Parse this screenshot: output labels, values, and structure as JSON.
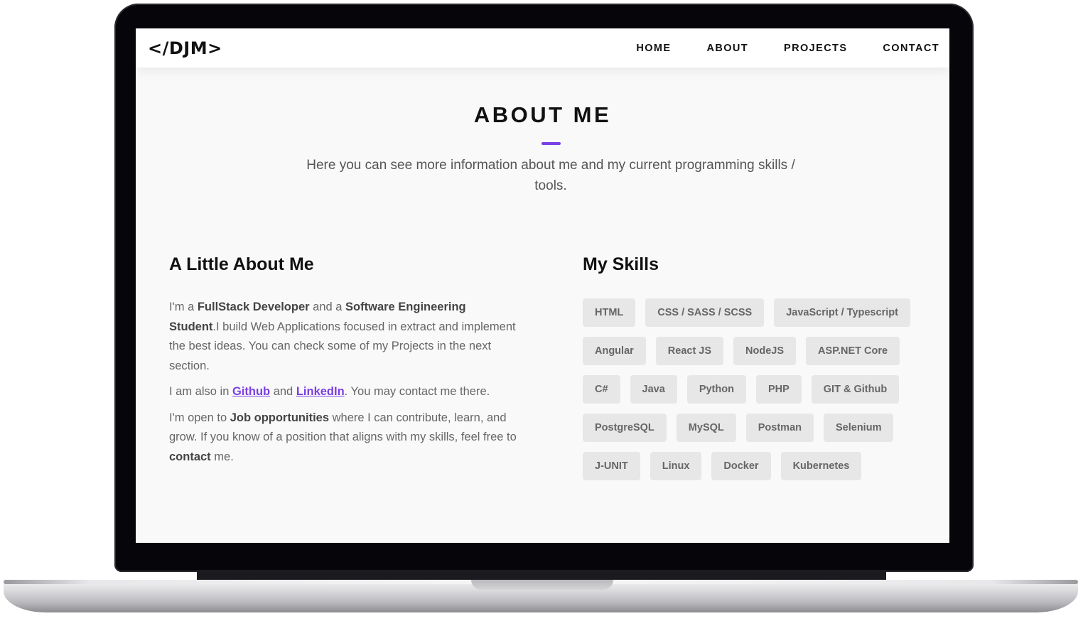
{
  "brand": {
    "logo": "</DJM>"
  },
  "nav": {
    "items": [
      {
        "label": "HOME"
      },
      {
        "label": "ABOUT"
      },
      {
        "label": "PROJECTS"
      },
      {
        "label": "CONTACT"
      }
    ]
  },
  "section": {
    "title": "ABOUT ME",
    "subtitle": "Here you can see more information about me and my current programming skills / tools."
  },
  "about": {
    "heading": "A Little About Me",
    "p1": {
      "t1": "I'm a ",
      "b1": "FullStack Developer",
      "t2": " and a ",
      "b2": "Software Engineering Student",
      "t3": ".I build Web Applications focused in extract and implement the best ideas. You can check some of my Projects in the next section."
    },
    "p2": {
      "t1": "I am also in ",
      "link1": "Github",
      "t2": " and ",
      "link2": "LinkedIn",
      "t3": ". You may contact me there."
    },
    "p3": {
      "t1": "I'm open to ",
      "b1": "Job opportunities",
      "t2": " where I can contribute, learn, and grow. If you know of a position that aligns with my skills, feel free to ",
      "b2": "contact",
      "t3": " me."
    }
  },
  "skills": {
    "heading": "My Skills",
    "items": [
      "HTML",
      "CSS / SASS / SCSS",
      "JavaScript / Typescript",
      "Angular",
      "React JS",
      "NodeJS",
      "ASP.NET Core",
      "C#",
      "Java",
      "Python",
      "PHP",
      "GIT & Github",
      "PostgreSQL",
      "MySQL",
      "Postman",
      "Selenium",
      "J-UNIT",
      "Linux",
      "Docker",
      "Kubernetes"
    ]
  },
  "colors": {
    "accent": "#7b3fe4",
    "chip_bg": "#e7e7e7",
    "page_bg": "#f9f9fa"
  }
}
